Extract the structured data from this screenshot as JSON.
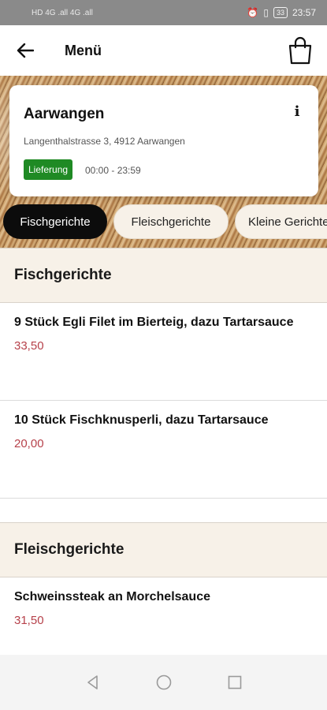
{
  "status_bar": {
    "left_text": "HD  4G  .all  4G  .all",
    "battery": "33",
    "time": "23:57"
  },
  "header": {
    "title": "Menü"
  },
  "store": {
    "name": "Aarwangen",
    "address": "Langenthalstrasse 3, 4912 Aarwangen",
    "delivery_badge": "Lieferung",
    "hours": "00:00 - 23:59"
  },
  "tabs": [
    {
      "label": "Fischgerichte",
      "active": true
    },
    {
      "label": "Fleischgerichte",
      "active": false
    },
    {
      "label": "Kleine Gerichte",
      "active": false
    }
  ],
  "sections": [
    {
      "title": "Fischgerichte",
      "dishes": [
        {
          "name": "9 Stück Egli Filet im Bierteig, dazu Tartarsauce",
          "price": "33,50"
        },
        {
          "name": "10 Stück Fischknusperli, dazu Tartarsauce",
          "price": "20,00"
        }
      ]
    },
    {
      "title": "Fleischgerichte",
      "dishes": [
        {
          "name": "Schweinssteak an Morchelsauce",
          "price": "31,50"
        }
      ]
    }
  ],
  "colors": {
    "active_tab": "#0c0c0c",
    "badge": "#1f8a24",
    "price": "#b6414a",
    "section_bg": "#f7f1e8"
  }
}
